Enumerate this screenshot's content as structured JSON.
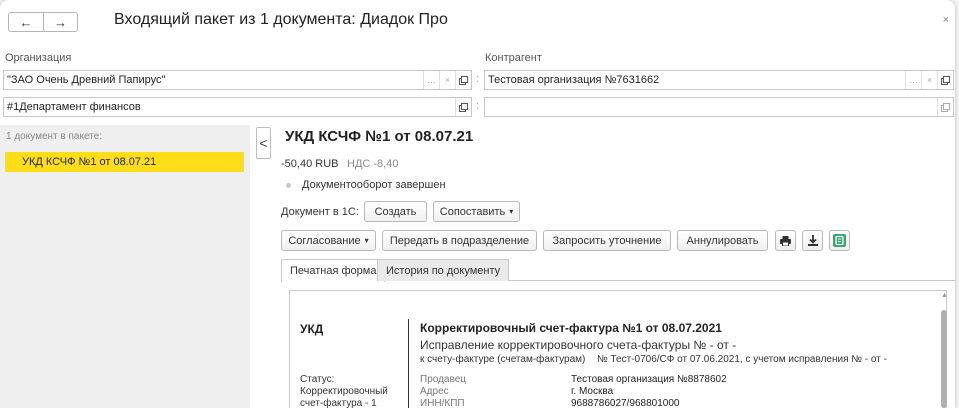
{
  "window": {
    "title": "Входящий пакет из 1 документа: Диадок Про",
    "back_icon": "←",
    "forward_icon": "→",
    "close_icon": "×"
  },
  "org": {
    "label": "Организация",
    "value": "\"ЗАО Очень Древний Папирус\"",
    "department": "#1Департамент финансов"
  },
  "contractor": {
    "label": "Контрагент",
    "value": "Тестовая организация №7631662"
  },
  "left": {
    "caption": "1 документ в пакете:",
    "items": [
      "УКД КСЧФ №1 от 08.07.21"
    ]
  },
  "doc": {
    "title": "УКД КСЧФ №1 от 08.07.21",
    "amount": "-50,40  RUB",
    "vat": "НДС -8,40",
    "status": "Документооборот завершен",
    "doc1c_label": "Документ в 1С:",
    "create_btn": "Создать",
    "compare_btn": "Сопоставить",
    "approve_btn": "Согласование",
    "transfer_btn": "Передать в подразделение",
    "clarify_btn": "Запросить уточнение",
    "annul_btn": "Аннулировать"
  },
  "tabs": [
    "Печатная форма",
    "История по документу"
  ],
  "print_form": {
    "heading": "УКД",
    "title": "Корректировочный счет-фактура №1 от 08.07.2021",
    "subtitle": "Исправление корректировочного счета-фактуры № - от -",
    "invoice_ref_label": "к счету-фактуре (счетам-фактурам)",
    "invoice_ref_value": "№ Тест-0706/СФ от 07.06.2021, с учетом исправления № - от -",
    "status_lines": [
      "Статус:",
      "Корректировочный",
      "счет-фактура - 1"
    ],
    "rows": [
      {
        "key": "Продавец",
        "value": "Тестовая организация №8878602"
      },
      {
        "key": "Адрес",
        "value": "г. Москва"
      },
      {
        "key": "ИНН/КПП",
        "value": "9688786027/968801000"
      }
    ]
  },
  "colors": {
    "selected_item": "#fdde19",
    "panel_bg": "#efefef",
    "accent_green": "#2ea86b"
  }
}
